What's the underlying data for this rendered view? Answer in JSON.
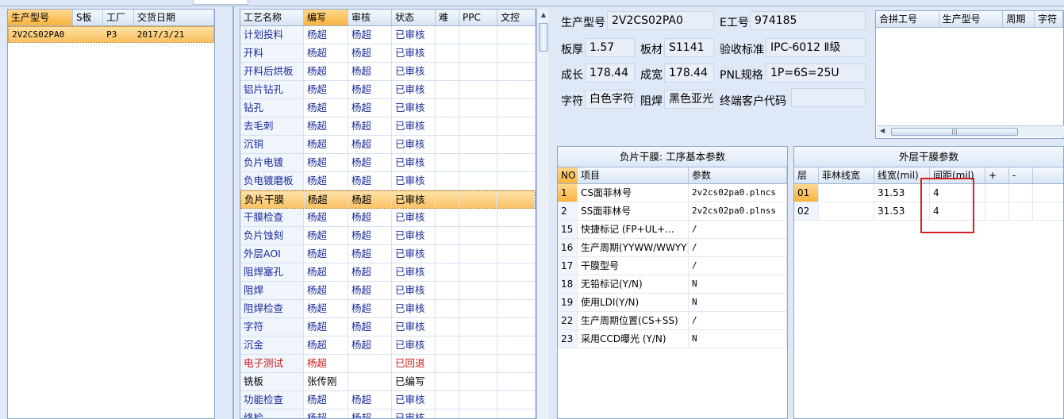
{
  "product_list": {
    "headers": [
      "生产型号",
      "S板",
      "工厂",
      "交货日期"
    ],
    "rows": [
      [
        "2V2CS02PA0",
        "",
        "P3",
        "2017/3/21"
      ]
    ]
  },
  "process_grid": {
    "headers": [
      "工艺名称",
      "编写",
      "审核",
      "状态",
      "难",
      "PPC",
      "文控"
    ],
    "rows": [
      [
        "计划投料",
        "杨超",
        "杨超",
        "已审核"
      ],
      [
        "开料",
        "杨超",
        "杨超",
        "已审核"
      ],
      [
        "开料后烘板",
        "杨超",
        "杨超",
        "已审核"
      ],
      [
        "铝片钻孔",
        "杨超",
        "杨超",
        "已审核"
      ],
      [
        "钻孔",
        "杨超",
        "杨超",
        "已审核"
      ],
      [
        "去毛刺",
        "杨超",
        "杨超",
        "已审核"
      ],
      [
        "沉铜",
        "杨超",
        "杨超",
        "已审核"
      ],
      [
        "负片电镀",
        "杨超",
        "杨超",
        "已审核"
      ],
      [
        "负电镀磨板",
        "杨超",
        "杨超",
        "已审核"
      ],
      [
        "负片干膜",
        "杨超",
        "杨超",
        "已审核"
      ],
      [
        "干膜检查",
        "杨超",
        "杨超",
        "已审核"
      ],
      [
        "负片蚀刻",
        "杨超",
        "杨超",
        "已审核"
      ],
      [
        "外层AOI",
        "杨超",
        "杨超",
        "已审核"
      ],
      [
        "阻焊塞孔",
        "杨超",
        "杨超",
        "已审核"
      ],
      [
        "阻焊",
        "杨超",
        "杨超",
        "已审核"
      ],
      [
        "阻焊检查",
        "杨超",
        "杨超",
        "已审核"
      ],
      [
        "字符",
        "杨超",
        "杨超",
        "已审核"
      ],
      [
        "沉金",
        "杨超",
        "杨超",
        "已审核"
      ],
      [
        "电子测试",
        "杨超",
        "",
        "已回退"
      ],
      [
        "铣板",
        "张传刚",
        "",
        "已编写"
      ],
      [
        "功能检查",
        "杨超",
        "杨超",
        "已审核"
      ],
      [
        "终检",
        "杨超",
        "杨超",
        "已审核"
      ]
    ]
  },
  "info": {
    "model_label": "生产型号",
    "model_value": "2V2CS02PA0",
    "e_label": "E工号",
    "e_value": "974185",
    "thick_label": "板厚",
    "thick_value": "1.57",
    "mat_label": "板材",
    "mat_value": "S1141",
    "std_label": "验收标准",
    "std_value": "IPC-6012 Ⅱ级",
    "len_label": "成长",
    "len_value": "178.44",
    "wid_label": "成宽",
    "wid_value": "178.44",
    "pnl_label": "PNL规格",
    "pnl_value": "1P=6S=25U",
    "char_label": "字符",
    "char_value": "白色字符",
    "mask_label": "阻焊",
    "mask_value": "黑色亚光",
    "cust_label": "终端客户代码",
    "cust_value": ""
  },
  "merge_table": {
    "headers": [
      "合拼工号",
      "生产型号",
      "周期",
      "字符"
    ]
  },
  "neg_panel": {
    "title": "负片干膜: 工序基本参数",
    "headers": [
      "NO",
      "项目",
      "参数"
    ],
    "rows": [
      [
        "1",
        "CS面菲林号",
        "2v2cs02pa0.plncs"
      ],
      [
        "2",
        "SS面菲林号",
        "2v2cs02pa0.plnss"
      ],
      [
        "15",
        "快捷标记 (FP+UL+...",
        "/"
      ],
      [
        "16",
        "生产周期(YYWW/WWYY)",
        "/"
      ],
      [
        "17",
        "干膜型号",
        "/"
      ],
      [
        "18",
        "无铅标记(Y/N)",
        "N"
      ],
      [
        "19",
        "使用LDI(Y/N)",
        "N"
      ],
      [
        "22",
        "生产周期位置(CS+SS)",
        "/"
      ],
      [
        "23",
        "采用CCD曝光 (Y/N)",
        "N"
      ]
    ]
  },
  "outer_panel": {
    "title": "外层干膜参数",
    "headers": [
      "层",
      "菲林线宽",
      "线宽(mil)",
      "间距(mil)",
      "+",
      "-"
    ],
    "rows": [
      [
        "01",
        "",
        "31.53",
        "4"
      ],
      [
        "02",
        "",
        "31.53",
        "4"
      ]
    ]
  },
  "colors": {
    "accent": "#f7b33c",
    "status_rejected": "#d01818",
    "highlight_box": "#d42020"
  }
}
